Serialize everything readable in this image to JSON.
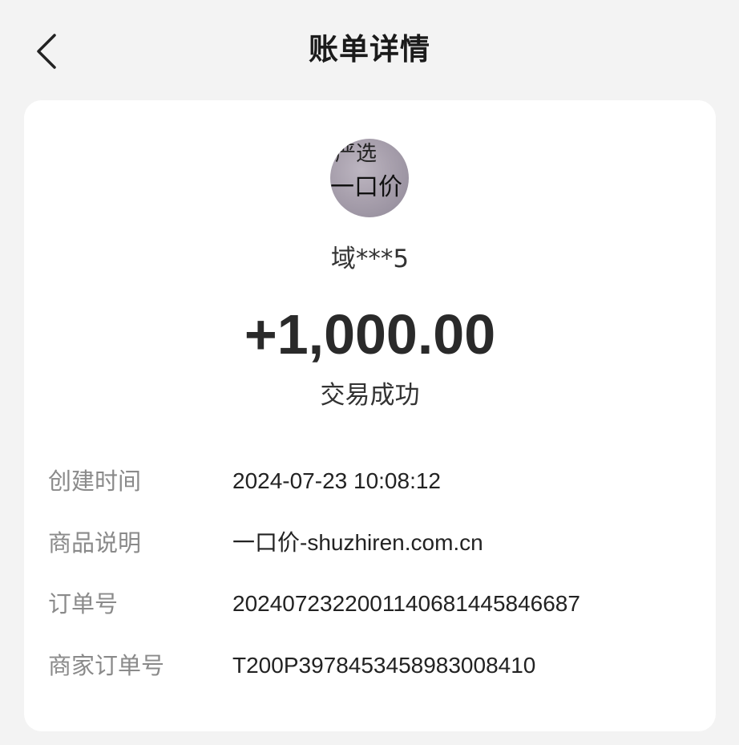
{
  "header": {
    "title": "账单详情",
    "back_icon": "chevron-left-icon"
  },
  "counterparty": {
    "avatar_line1": "严选",
    "avatar_line2": "一口价",
    "name": "域***5"
  },
  "transaction": {
    "amount": "+1,000.00",
    "status": "交易成功"
  },
  "details": [
    {
      "label": "创建时间",
      "value": "2024-07-23 10:08:12"
    },
    {
      "label": "商品说明",
      "value": "一口价-shuzhiren.com.cn"
    },
    {
      "label": "订单号",
      "value": "2024072322001140681445846687"
    },
    {
      "label": "商家订单号",
      "value": "T200P3978453458983008410"
    }
  ]
}
